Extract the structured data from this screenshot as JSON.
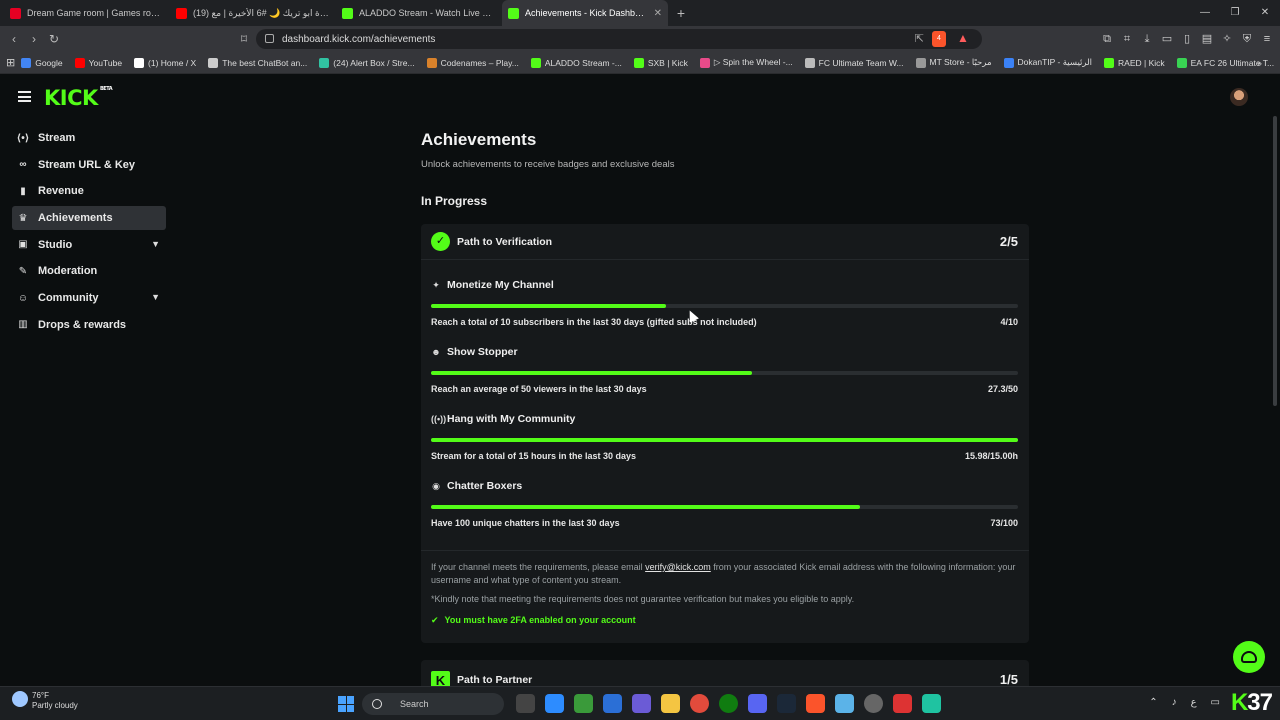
{
  "browser": {
    "tabs": [
      {
        "title": "Dream Game room | Games room in...",
        "color": "#e60023",
        "active": false
      },
      {
        "title": "(19) سمرة ابو تريك 🌙 #6 الأخيرة | مع ...",
        "color": "#ff0000",
        "active": false
      },
      {
        "title": "ALADDO Stream - Watch Live on Kick",
        "color": "#53fc18",
        "active": false
      },
      {
        "title": "Achievements - Kick Dashboard",
        "color": "#53fc18",
        "active": true
      }
    ],
    "url": "dashboard.kick.com/achievements",
    "brave_badge": "4",
    "bookmarks": [
      {
        "label": "Google",
        "color": "#4285f4"
      },
      {
        "label": "YouTube",
        "color": "#ff0000"
      },
      {
        "label": "(1) Home / X",
        "color": "#ffffff"
      },
      {
        "label": "The best ChatBot an...",
        "color": "#cccccc"
      },
      {
        "label": "(24) Alert Box / Stre...",
        "color": "#31c3a2"
      },
      {
        "label": "Codenames – Play...",
        "color": "#d9822b"
      },
      {
        "label": "ALADDO Stream -...",
        "color": "#53fc18"
      },
      {
        "label": "SXB | Kick",
        "color": "#53fc18"
      },
      {
        "label": "▷ Spin the Wheel -...",
        "color": "#e94b8a"
      },
      {
        "label": "FC Ultimate Team W...",
        "color": "#bbbbbb"
      },
      {
        "label": "MT Store - مرحبًا",
        "color": "#999999"
      },
      {
        "label": "DokanTIP - الرئيسية",
        "color": "#3b82f6"
      },
      {
        "label": "RAED | Kick",
        "color": "#53fc18"
      },
      {
        "label": "EA FC 26 Ultimate T...",
        "color": "#39d353"
      }
    ]
  },
  "sidebar": {
    "items": [
      {
        "label": "Stream",
        "icon": "broadcast-icon",
        "glyph": "⟨•⟩"
      },
      {
        "label": "Stream URL & Key",
        "icon": "link-icon",
        "glyph": "∞"
      },
      {
        "label": "Revenue",
        "icon": "chart-icon",
        "glyph": "▮"
      },
      {
        "label": "Achievements",
        "icon": "trophy-icon",
        "glyph": "♛"
      },
      {
        "label": "Studio",
        "icon": "layers-icon",
        "glyph": "▣"
      },
      {
        "label": "Moderation",
        "icon": "wrench-icon",
        "glyph": "✎"
      },
      {
        "label": "Community",
        "icon": "users-icon",
        "glyph": "☺"
      },
      {
        "label": "Drops & rewards",
        "icon": "gift-icon",
        "glyph": "▥"
      }
    ]
  },
  "main": {
    "title": "Achievements",
    "subtitle": "Unlock achievements to receive badges and exclusive deals",
    "section": "In Progress",
    "verification": {
      "title": "Path to Verification",
      "count": "2/5",
      "achievements": [
        {
          "title": "Monetize My Channel",
          "desc": "Reach a total of 10 subscribers in the last 30 days (gifted subs not included)",
          "value": "4/10",
          "progress": 0.4,
          "icon": "sparkle-icon",
          "glyph": "✦"
        },
        {
          "title": "Show Stopper",
          "desc": "Reach an average of 50 viewers in the last 30 days",
          "value": "27.3/50",
          "progress": 0.546,
          "icon": "viewers-icon",
          "glyph": "☻"
        },
        {
          "title": "Hang with My Community",
          "desc": "Stream for a total of 15 hours in the last 30 days",
          "value": "15.98/15.00h",
          "progress": 1.0,
          "icon": "signal-icon",
          "glyph": "((•))"
        },
        {
          "title": "Chatter Boxers",
          "desc": "Have 100 unique chatters in the last 30 days",
          "value": "73/100",
          "progress": 0.73,
          "icon": "chat-icon",
          "glyph": "◉"
        }
      ],
      "footer_pre": "If your channel meets the requirements, please email ",
      "footer_link": "verify@kick.com",
      "footer_post": " from your associated Kick email address with the following information: your username and what type of content you stream.",
      "note": "*Kindly note that meeting the requirements does not guarantee verification but makes you eligible to apply.",
      "twofa": "You must have 2FA enabled on your account"
    },
    "partner": {
      "title": "Path to Partner",
      "count": "1/5"
    }
  },
  "taskbar": {
    "temp": "76°F",
    "condition": "Partly cloudy",
    "search": "Search",
    "tray_lang": "ع",
    "corner": "37"
  },
  "colors": {
    "accent": "#53fc18",
    "bg": "#0b0e0f",
    "card": "#16191b"
  }
}
